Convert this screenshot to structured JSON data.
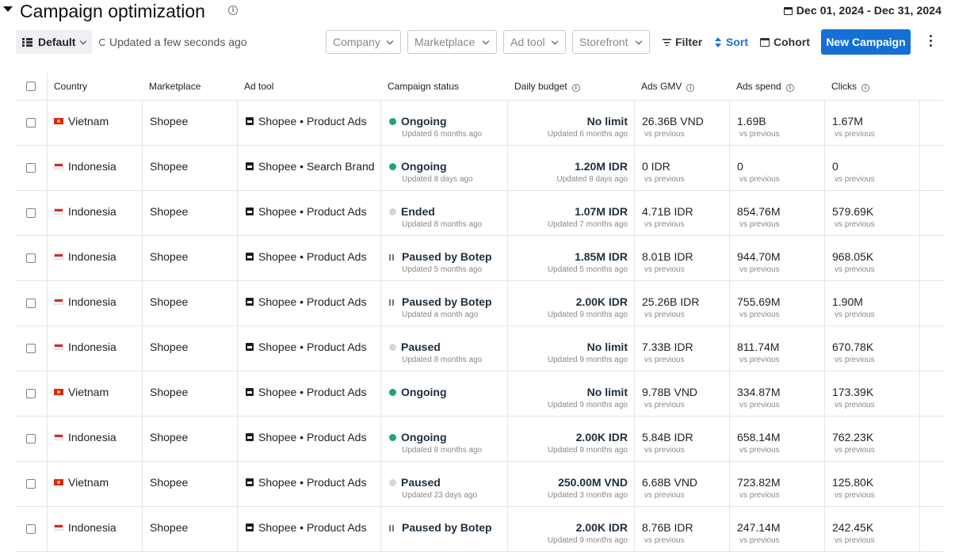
{
  "header": {
    "title": "Campaign optimization",
    "date_range": "Dec 01, 2024 - Dec 31, 2024"
  },
  "toolbar": {
    "view_label": "Default",
    "updated_text": "Updated a few seconds ago",
    "dropdowns": {
      "company": "Company",
      "marketplace": "Marketplace",
      "ad_tool": "Ad tool",
      "storefront": "Storefront"
    },
    "filter_label": "Filter",
    "sort_label": "Sort",
    "cohort_label": "Cohort",
    "new_campaign_label": "New Campaign"
  },
  "table": {
    "columns": [
      "Country",
      "Marketplace",
      "Ad tool",
      "Campaign status",
      "Daily budget",
      "Ads GMV",
      "Ads spend",
      "Clicks"
    ],
    "vs_previous": "vs previous",
    "rows": [
      {
        "country": "Vietnam",
        "flag": "vn",
        "marketplace": "Shopee",
        "ad_tool": "Shopee • Product Ads",
        "status": "Ongoing",
        "status_kind": "ongoing",
        "status_updated": "Updated 6 months ago",
        "budget": "No limit",
        "budget_updated": "Updated 6 months ago",
        "gmv": "26.36B VND",
        "spend": "1.69B",
        "clicks": "1.67M"
      },
      {
        "country": "Indonesia",
        "flag": "id",
        "marketplace": "Shopee",
        "ad_tool": "Shopee • Search Brand",
        "status": "Ongoing",
        "status_kind": "ongoing",
        "status_updated": "Updated 8 days ago",
        "budget": "1.20M IDR",
        "budget_updated": "Updated 8 days ago",
        "gmv": "0 IDR",
        "spend": "0",
        "clicks": "0"
      },
      {
        "country": "Indonesia",
        "flag": "id",
        "marketplace": "Shopee",
        "ad_tool": "Shopee • Product Ads",
        "status": "Ended",
        "status_kind": "gray",
        "status_updated": "Updated 8 months ago",
        "budget": "1.07M IDR",
        "budget_updated": "Updated 7 months ago",
        "gmv": "4.71B IDR",
        "spend": "854.76M",
        "clicks": "579.69K"
      },
      {
        "country": "Indonesia",
        "flag": "id",
        "marketplace": "Shopee",
        "ad_tool": "Shopee • Product Ads",
        "status": "Paused by Botep",
        "status_kind": "paused-bot",
        "status_updated": "Updated 5 months ago",
        "budget": "1.85M IDR",
        "budget_updated": "Updated 5 months ago",
        "gmv": "8.01B IDR",
        "spend": "944.70M",
        "clicks": "968.05K"
      },
      {
        "country": "Indonesia",
        "flag": "id",
        "marketplace": "Shopee",
        "ad_tool": "Shopee • Product Ads",
        "status": "Paused by Botep",
        "status_kind": "paused-bot",
        "status_updated": "Updated a month ago",
        "budget": "2.00K IDR",
        "budget_updated": "Updated 9 months ago",
        "gmv": "25.26B IDR",
        "spend": "755.69M",
        "clicks": "1.90M"
      },
      {
        "country": "Indonesia",
        "flag": "id",
        "marketplace": "Shopee",
        "ad_tool": "Shopee • Product Ads",
        "status": "Paused",
        "status_kind": "gray",
        "status_updated": "Updated 8 months ago",
        "budget": "No limit",
        "budget_updated": "Updated 9 months ago",
        "gmv": "7.33B IDR",
        "spend": "811.74M",
        "clicks": "670.78K"
      },
      {
        "country": "Vietnam",
        "flag": "vn",
        "marketplace": "Shopee",
        "ad_tool": "Shopee • Product Ads",
        "status": "Ongoing",
        "status_kind": "ongoing",
        "status_updated": "",
        "budget": "No limit",
        "budget_updated": "Updated 9 months ago",
        "gmv": "9.78B VND",
        "spend": "334.87M",
        "clicks": "173.39K"
      },
      {
        "country": "Indonesia",
        "flag": "id",
        "marketplace": "Shopee",
        "ad_tool": "Shopee • Product Ads",
        "status": "Ongoing",
        "status_kind": "ongoing",
        "status_updated": "Updated 8 months ago",
        "budget": "2.00K IDR",
        "budget_updated": "Updated 9 months ago",
        "gmv": "5.84B IDR",
        "spend": "658.14M",
        "clicks": "762.23K"
      },
      {
        "country": "Vietnam",
        "flag": "vn",
        "marketplace": "Shopee",
        "ad_tool": "Shopee • Product Ads",
        "status": "Paused",
        "status_kind": "gray",
        "status_updated": "Updated 23 days ago",
        "budget": "250.00M VND",
        "budget_updated": "Updated 3 months ago",
        "gmv": "6.68B VND",
        "spend": "723.82M",
        "clicks": "125.80K"
      },
      {
        "country": "Indonesia",
        "flag": "id",
        "marketplace": "Shopee",
        "ad_tool": "Shopee • Product Ads",
        "status": "Paused by Botep",
        "status_kind": "paused-bot",
        "status_updated": "",
        "budget": "2.00K IDR",
        "budget_updated": "Updated 9 months ago",
        "gmv": "8.76B IDR",
        "spend": "247.14M",
        "clicks": "242.45K"
      }
    ]
  }
}
